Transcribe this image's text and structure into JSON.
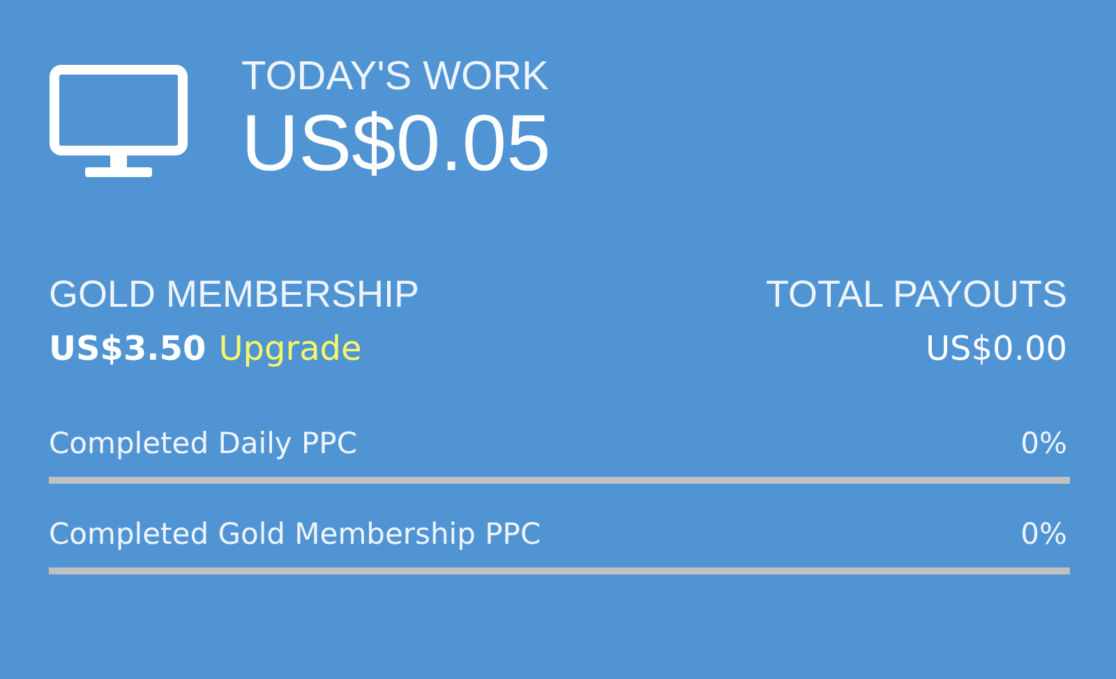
{
  "today": {
    "label": "TODAY'S WORK",
    "amount": "US$0.05"
  },
  "membership": {
    "label": "GOLD MEMBERSHIP",
    "price": "US$3.50",
    "link": "Upgrade"
  },
  "payouts": {
    "label": "TOTAL PAYOUTS",
    "amount": "US$0.00"
  },
  "progress": [
    {
      "label": "Completed Daily PPC",
      "reading": "0%",
      "level": 0
    },
    {
      "label": "Completed Gold Membership PPC",
      "reading": "0%",
      "level": 0
    }
  ]
}
